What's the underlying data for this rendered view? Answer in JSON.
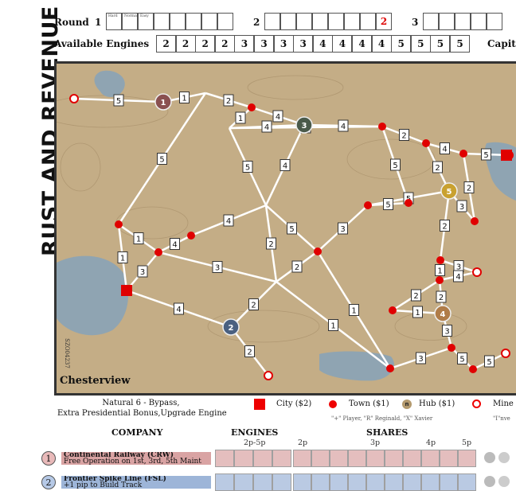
{
  "title": "RUST AND REVENUE",
  "rounds": {
    "label": "Round",
    "numbers": [
      "1",
      "2",
      "3"
    ],
    "round1_minis": [
      "Hard",
      "Normal",
      "Easy"
    ],
    "round2_marker": "2"
  },
  "engines": {
    "label": "Available Engines",
    "values": [
      "2",
      "2",
      "2",
      "2",
      "3",
      "3",
      "3",
      "3",
      "4",
      "4",
      "4",
      "4",
      "5",
      "5",
      "5",
      "5"
    ]
  },
  "capital_label": "Capit",
  "map": {
    "city_name": "Chesterview",
    "code": "SZO04237",
    "hubs": [
      "1",
      "2",
      "3",
      "4",
      "5"
    ],
    "track_costs": [
      "5",
      "1",
      "2",
      "1",
      "4",
      "4",
      "1",
      "4",
      "2",
      "4",
      "5",
      "5",
      "5",
      "5",
      "2",
      "3",
      "2",
      "5",
      "4",
      "5",
      "1",
      "4",
      "4",
      "5",
      "3",
      "1",
      "3",
      "3",
      "4",
      "2",
      "2",
      "2",
      "2",
      "1",
      "1",
      "3",
      "5",
      "5",
      "3",
      "2",
      "1",
      "3",
      "4",
      "2",
      "1",
      "2",
      "3",
      "5",
      "1",
      "4",
      "4",
      "4",
      "1",
      "4",
      "4",
      "3",
      "4",
      "4"
    ],
    "colors": {
      "land": "#c4ad86",
      "water": "#8fa4b2",
      "track": "#ffffff",
      "city": "#e00000"
    }
  },
  "legend": {
    "note_line1": "Natural 6 - Bypass,",
    "note_line2": "Extra Presidential Bonus,Upgrade Engine",
    "city": "City ($2)",
    "town": "Town ($1)",
    "hub_glyph": "n",
    "hub": "Hub ($1)",
    "mine": "Mine",
    "players_note": "\"+\" Player, \"R\" Reginald, \"X\" Xavier",
    "inv_note": "\"I\"nve"
  },
  "table": {
    "company_header": "COMPANY",
    "engines_header": "ENGINES",
    "shares_header": "SHARES",
    "engines_sub": "2p-5p",
    "shares_sub": [
      "2p",
      "3p",
      "4p",
      "5p"
    ],
    "companies": [
      {
        "num": "1",
        "name": "Continental Railway (CRW)",
        "ability": "Free Operation on 1st, 3rd, 5th Maint",
        "color": "#d9a3a3",
        "badge": "#e8b9b9"
      },
      {
        "num": "2",
        "name": "Frontier Spike Line (FSL)",
        "ability": "+1 pip to Build Track",
        "color": "#9db5d8",
        "badge": "#b6c9e6"
      }
    ]
  }
}
